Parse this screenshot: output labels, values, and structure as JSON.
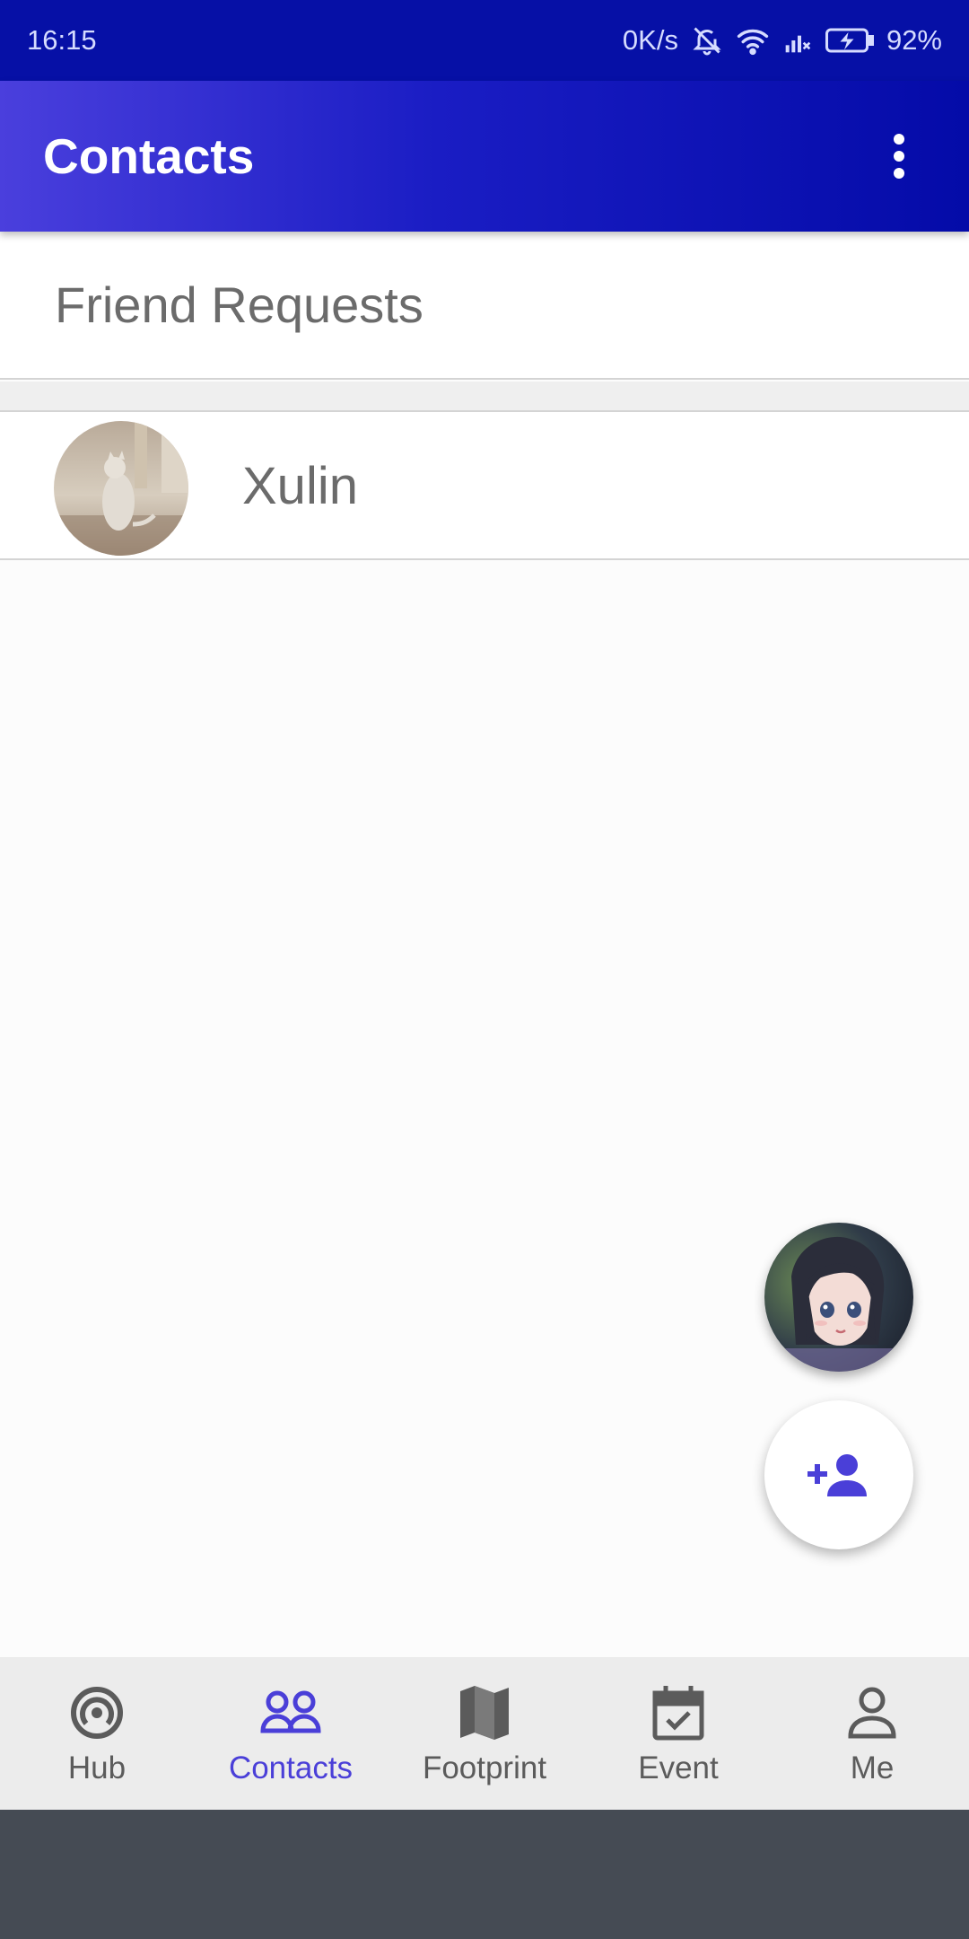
{
  "status_bar": {
    "time": "16:15",
    "network_speed": "0K/s",
    "battery": "92%",
    "icons": [
      "bell-off-icon",
      "wifi-icon",
      "cell-signal-off-icon",
      "battery-charging-icon"
    ]
  },
  "app_bar": {
    "title": "Contacts",
    "menu_icon": "more-vert-icon"
  },
  "sections": {
    "friend_requests_label": "Friend Requests"
  },
  "contacts": [
    {
      "name": "Xulin",
      "avatar": "cat-photo-avatar"
    }
  ],
  "fabs": {
    "profile_avatar": "anime-girl-avatar",
    "add_contact_icon": "person-add-icon"
  },
  "bottom_nav": {
    "active": "Contacts",
    "items": [
      {
        "label": "Hub",
        "icon": "hub-broadcast-icon"
      },
      {
        "label": "Contacts",
        "icon": "people-icon"
      },
      {
        "label": "Footprint",
        "icon": "map-icon"
      },
      {
        "label": "Event",
        "icon": "event-calendar-icon"
      },
      {
        "label": "Me",
        "icon": "person-icon"
      }
    ]
  },
  "colors": {
    "status_bar": "#0610a6",
    "app_bar_start": "#4a3fdd",
    "app_bar_end": "#040ba8",
    "accent": "#4a3fd8",
    "nav_background": "#ececec",
    "system_bar": "#454b54"
  }
}
